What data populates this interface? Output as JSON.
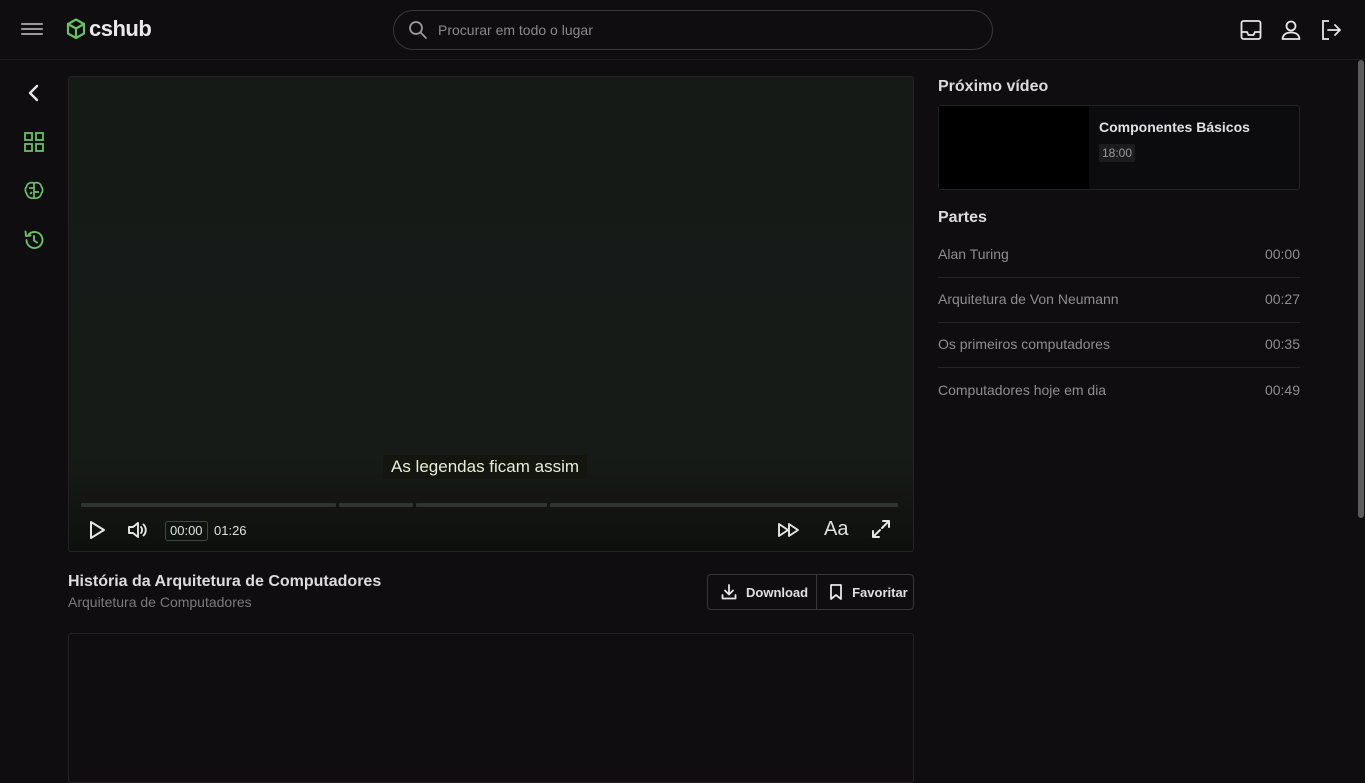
{
  "header": {
    "logo_text": "cshub",
    "search_placeholder": "Procurar em todo o lugar",
    "icons": [
      "inbox-icon",
      "user-icon",
      "logout-icon"
    ]
  },
  "sidebar": {
    "icons": [
      "chevron-left-icon",
      "grid-icon",
      "brain-icon",
      "history-icon"
    ]
  },
  "player": {
    "caption": "As legendas ficam assim",
    "current_time": "00:00",
    "total_time": "01:26",
    "captions_label": "Aa",
    "chapter_segments": [
      0.315,
      0.092,
      0.162,
      0.431
    ]
  },
  "video": {
    "title": "História da Arquitetura de Computadores",
    "subtitle": "Arquitetura de Computadores",
    "download_label": "Download",
    "favorite_label": "Favoritar"
  },
  "next": {
    "heading": "Próximo vídeo",
    "title": "Componentes Básicos",
    "duration": "18:00"
  },
  "parts": {
    "heading": "Partes",
    "items": [
      {
        "name": "Alan Turing",
        "time": "00:00"
      },
      {
        "name": "Arquitetura de Von Neumann",
        "time": "00:27"
      },
      {
        "name": "Os primeiros computadores",
        "time": "00:35"
      },
      {
        "name": "Computadores hoje em dia",
        "time": "00:49"
      }
    ]
  },
  "colors": {
    "accent": "#6abf69",
    "background": "#0f0d10"
  }
}
